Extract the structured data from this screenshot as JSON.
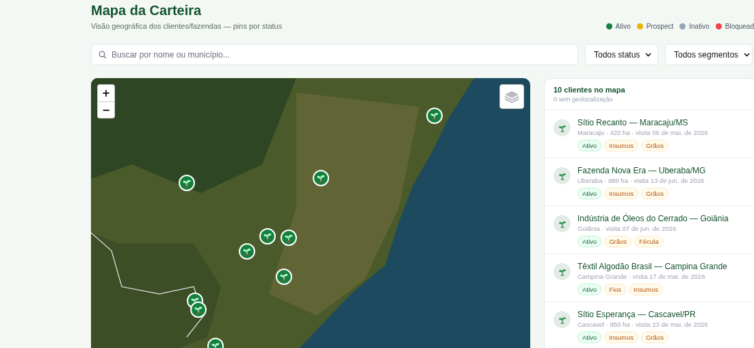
{
  "header": {
    "title": "Mapa da Carteira",
    "subtitle": "Visão geográfica dos clientes/fazendas — pins por status"
  },
  "legend": [
    {
      "label": "Ativo",
      "color": "#15803d"
    },
    {
      "label": "Prospect",
      "color": "#eab308"
    },
    {
      "label": "Inativo",
      "color": "#94a3b8"
    },
    {
      "label": "Bloquead",
      "color": "#ef4444"
    }
  ],
  "search": {
    "placeholder": "Buscar por nome ou município..."
  },
  "filters": [
    {
      "value": "Todos status"
    },
    {
      "value": "Todos segmentos"
    }
  ],
  "map": {
    "zoom_in": "+",
    "zoom_out": "−",
    "pins": [
      {
        "color": "#15803d"
      },
      {
        "color": "#15803d"
      },
      {
        "color": "#15803d"
      },
      {
        "color": "#15803d"
      },
      {
        "color": "#15803d"
      },
      {
        "color": "#15803d"
      },
      {
        "color": "#15803d"
      },
      {
        "color": "#15803d"
      },
      {
        "color": "#15803d"
      },
      {
        "color": "#15803d"
      }
    ]
  },
  "panel": {
    "title": "10 clientes no mapa",
    "subtitle": "0 sem geolocalização",
    "clients": [
      {
        "name": "Sítio Recanto — Maracaju/MS",
        "meta": "Maracaju · 420 ha · visita 06 de mai. de 2026",
        "tags": [
          {
            "label": "Ativo",
            "kind": "status"
          },
          {
            "label": "Insumos",
            "kind": "segment"
          },
          {
            "label": "Grãos",
            "kind": "segment"
          }
        ]
      },
      {
        "name": "Fazenda Nova Era — Uberaba/MG",
        "meta": "Uberaba · 980 ha · visita 13 de jun. de 2026",
        "tags": [
          {
            "label": "Ativo",
            "kind": "status"
          },
          {
            "label": "Insumos",
            "kind": "segment"
          },
          {
            "label": "Grãos",
            "kind": "segment"
          }
        ]
      },
      {
        "name": "Indústria de Óleos do Cerrado — Goiânia",
        "meta": "Goiânia · visita 07 de jun. de 2026",
        "tags": [
          {
            "label": "Ativo",
            "kind": "status"
          },
          {
            "label": "Grãos",
            "kind": "segment"
          },
          {
            "label": "Fécula",
            "kind": "segment"
          }
        ]
      },
      {
        "name": "Têxtil Algodão Brasil — Campina Grande",
        "meta": "Campina Grande · visita 17 de mai. de 2026",
        "tags": [
          {
            "label": "Ativo",
            "kind": "status"
          },
          {
            "label": "Fios",
            "kind": "segment"
          },
          {
            "label": "Insumos",
            "kind": "segment"
          }
        ]
      },
      {
        "name": "Sítio Esperança — Cascavel/PR",
        "meta": "Cascavel · 850 ha · visita 23 de mai. de 2026",
        "tags": [
          {
            "label": "Ativo",
            "kind": "status"
          },
          {
            "label": "Insumos",
            "kind": "segment"
          },
          {
            "label": "Grãos",
            "kind": "segment"
          }
        ]
      }
    ]
  }
}
